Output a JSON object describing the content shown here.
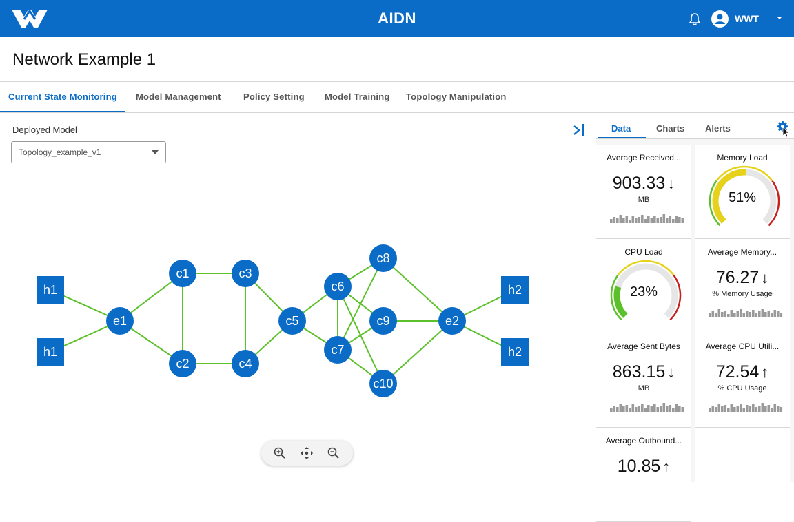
{
  "header": {
    "app_title": "AIDN",
    "user_name": "WWT",
    "icons": [
      "logo-icon",
      "bell-icon",
      "avatar-icon",
      "chevron-down-icon"
    ],
    "brand_color": "#0a6cc7"
  },
  "page": {
    "title": "Network Example 1"
  },
  "tabs": [
    {
      "label": "Current State Monitoring",
      "active": true
    },
    {
      "label": "Model Management",
      "active": false
    },
    {
      "label": "Policy Setting",
      "active": false
    },
    {
      "label": "Model Training",
      "active": false
    },
    {
      "label": "Topology Manipulation",
      "active": false
    }
  ],
  "deployed_model": {
    "label": "Deployed Model",
    "selected": "Topology_example_v1"
  },
  "topology": {
    "node_color": "#0a6cc7",
    "link_color": "#5cc02a",
    "nodes": [
      {
        "id": "h1a",
        "label": "h1",
        "shape": "square"
      },
      {
        "id": "h1b",
        "label": "h1",
        "shape": "square"
      },
      {
        "id": "e1",
        "label": "e1",
        "shape": "circle"
      },
      {
        "id": "c1",
        "label": "c1",
        "shape": "circle"
      },
      {
        "id": "c2",
        "label": "c2",
        "shape": "circle"
      },
      {
        "id": "c3",
        "label": "c3",
        "shape": "circle"
      },
      {
        "id": "c4",
        "label": "c4",
        "shape": "circle"
      },
      {
        "id": "c5",
        "label": "c5",
        "shape": "circle"
      },
      {
        "id": "c6",
        "label": "c6",
        "shape": "circle"
      },
      {
        "id": "c7",
        "label": "c7",
        "shape": "circle"
      },
      {
        "id": "c8",
        "label": "c8",
        "shape": "circle"
      },
      {
        "id": "c9",
        "label": "c9",
        "shape": "circle"
      },
      {
        "id": "c10",
        "label": "c10",
        "shape": "circle"
      },
      {
        "id": "e2",
        "label": "e2",
        "shape": "circle"
      },
      {
        "id": "h2a",
        "label": "h2",
        "shape": "square"
      },
      {
        "id": "h2b",
        "label": "h2",
        "shape": "square"
      }
    ],
    "links": [
      [
        "h1a",
        "e1"
      ],
      [
        "h1b",
        "e1"
      ],
      [
        "e1",
        "c1"
      ],
      [
        "e1",
        "c2"
      ],
      [
        "c1",
        "c2"
      ],
      [
        "c1",
        "c3"
      ],
      [
        "c2",
        "c4"
      ],
      [
        "c3",
        "c4"
      ],
      [
        "c3",
        "c5"
      ],
      [
        "c4",
        "c5"
      ],
      [
        "c5",
        "c6"
      ],
      [
        "c5",
        "c7"
      ],
      [
        "c6",
        "c7"
      ],
      [
        "c6",
        "c8"
      ],
      [
        "c6",
        "c9"
      ],
      [
        "c6",
        "c10"
      ],
      [
        "c7",
        "c8"
      ],
      [
        "c7",
        "c9"
      ],
      [
        "c7",
        "c10"
      ],
      [
        "c8",
        "e2"
      ],
      [
        "c9",
        "e2"
      ],
      [
        "c10",
        "e2"
      ],
      [
        "e2",
        "h2a"
      ],
      [
        "e2",
        "h2b"
      ]
    ]
  },
  "panel": {
    "tabs": [
      {
        "label": "Data",
        "active": true
      },
      {
        "label": "Charts",
        "active": false
      },
      {
        "label": "Alerts",
        "active": false
      }
    ],
    "cards_left": [
      {
        "type": "stat",
        "title": "Average Received...",
        "value": "903.33",
        "trend": "↓",
        "unit": "MB"
      },
      {
        "type": "gauge",
        "title": "CPU Load",
        "value": "23%",
        "level": 0.23
      },
      {
        "type": "stat",
        "title": "Average Sent Bytes",
        "value": "863.15",
        "trend": "↓",
        "unit": "MB"
      },
      {
        "type": "stat",
        "title": "Average Outbound...",
        "value": "10.85",
        "trend": "↑",
        "unit": ""
      }
    ],
    "cards_right": [
      {
        "type": "gauge",
        "title": "Memory Load",
        "value": "51%",
        "level": 0.51
      },
      {
        "type": "stat",
        "title": "Average Memory...",
        "value": "76.27",
        "trend": "↓",
        "unit": "% Memory Usage"
      },
      {
        "type": "stat",
        "title": "Average CPU Utili...",
        "value": "72.54",
        "trend": "↑",
        "unit": "% CPU Usage"
      }
    ],
    "gauge_colors": {
      "green": "#5cc02a",
      "yellow": "#e6d21a",
      "red": "#c8201e",
      "track": "#e6e6e6"
    }
  }
}
